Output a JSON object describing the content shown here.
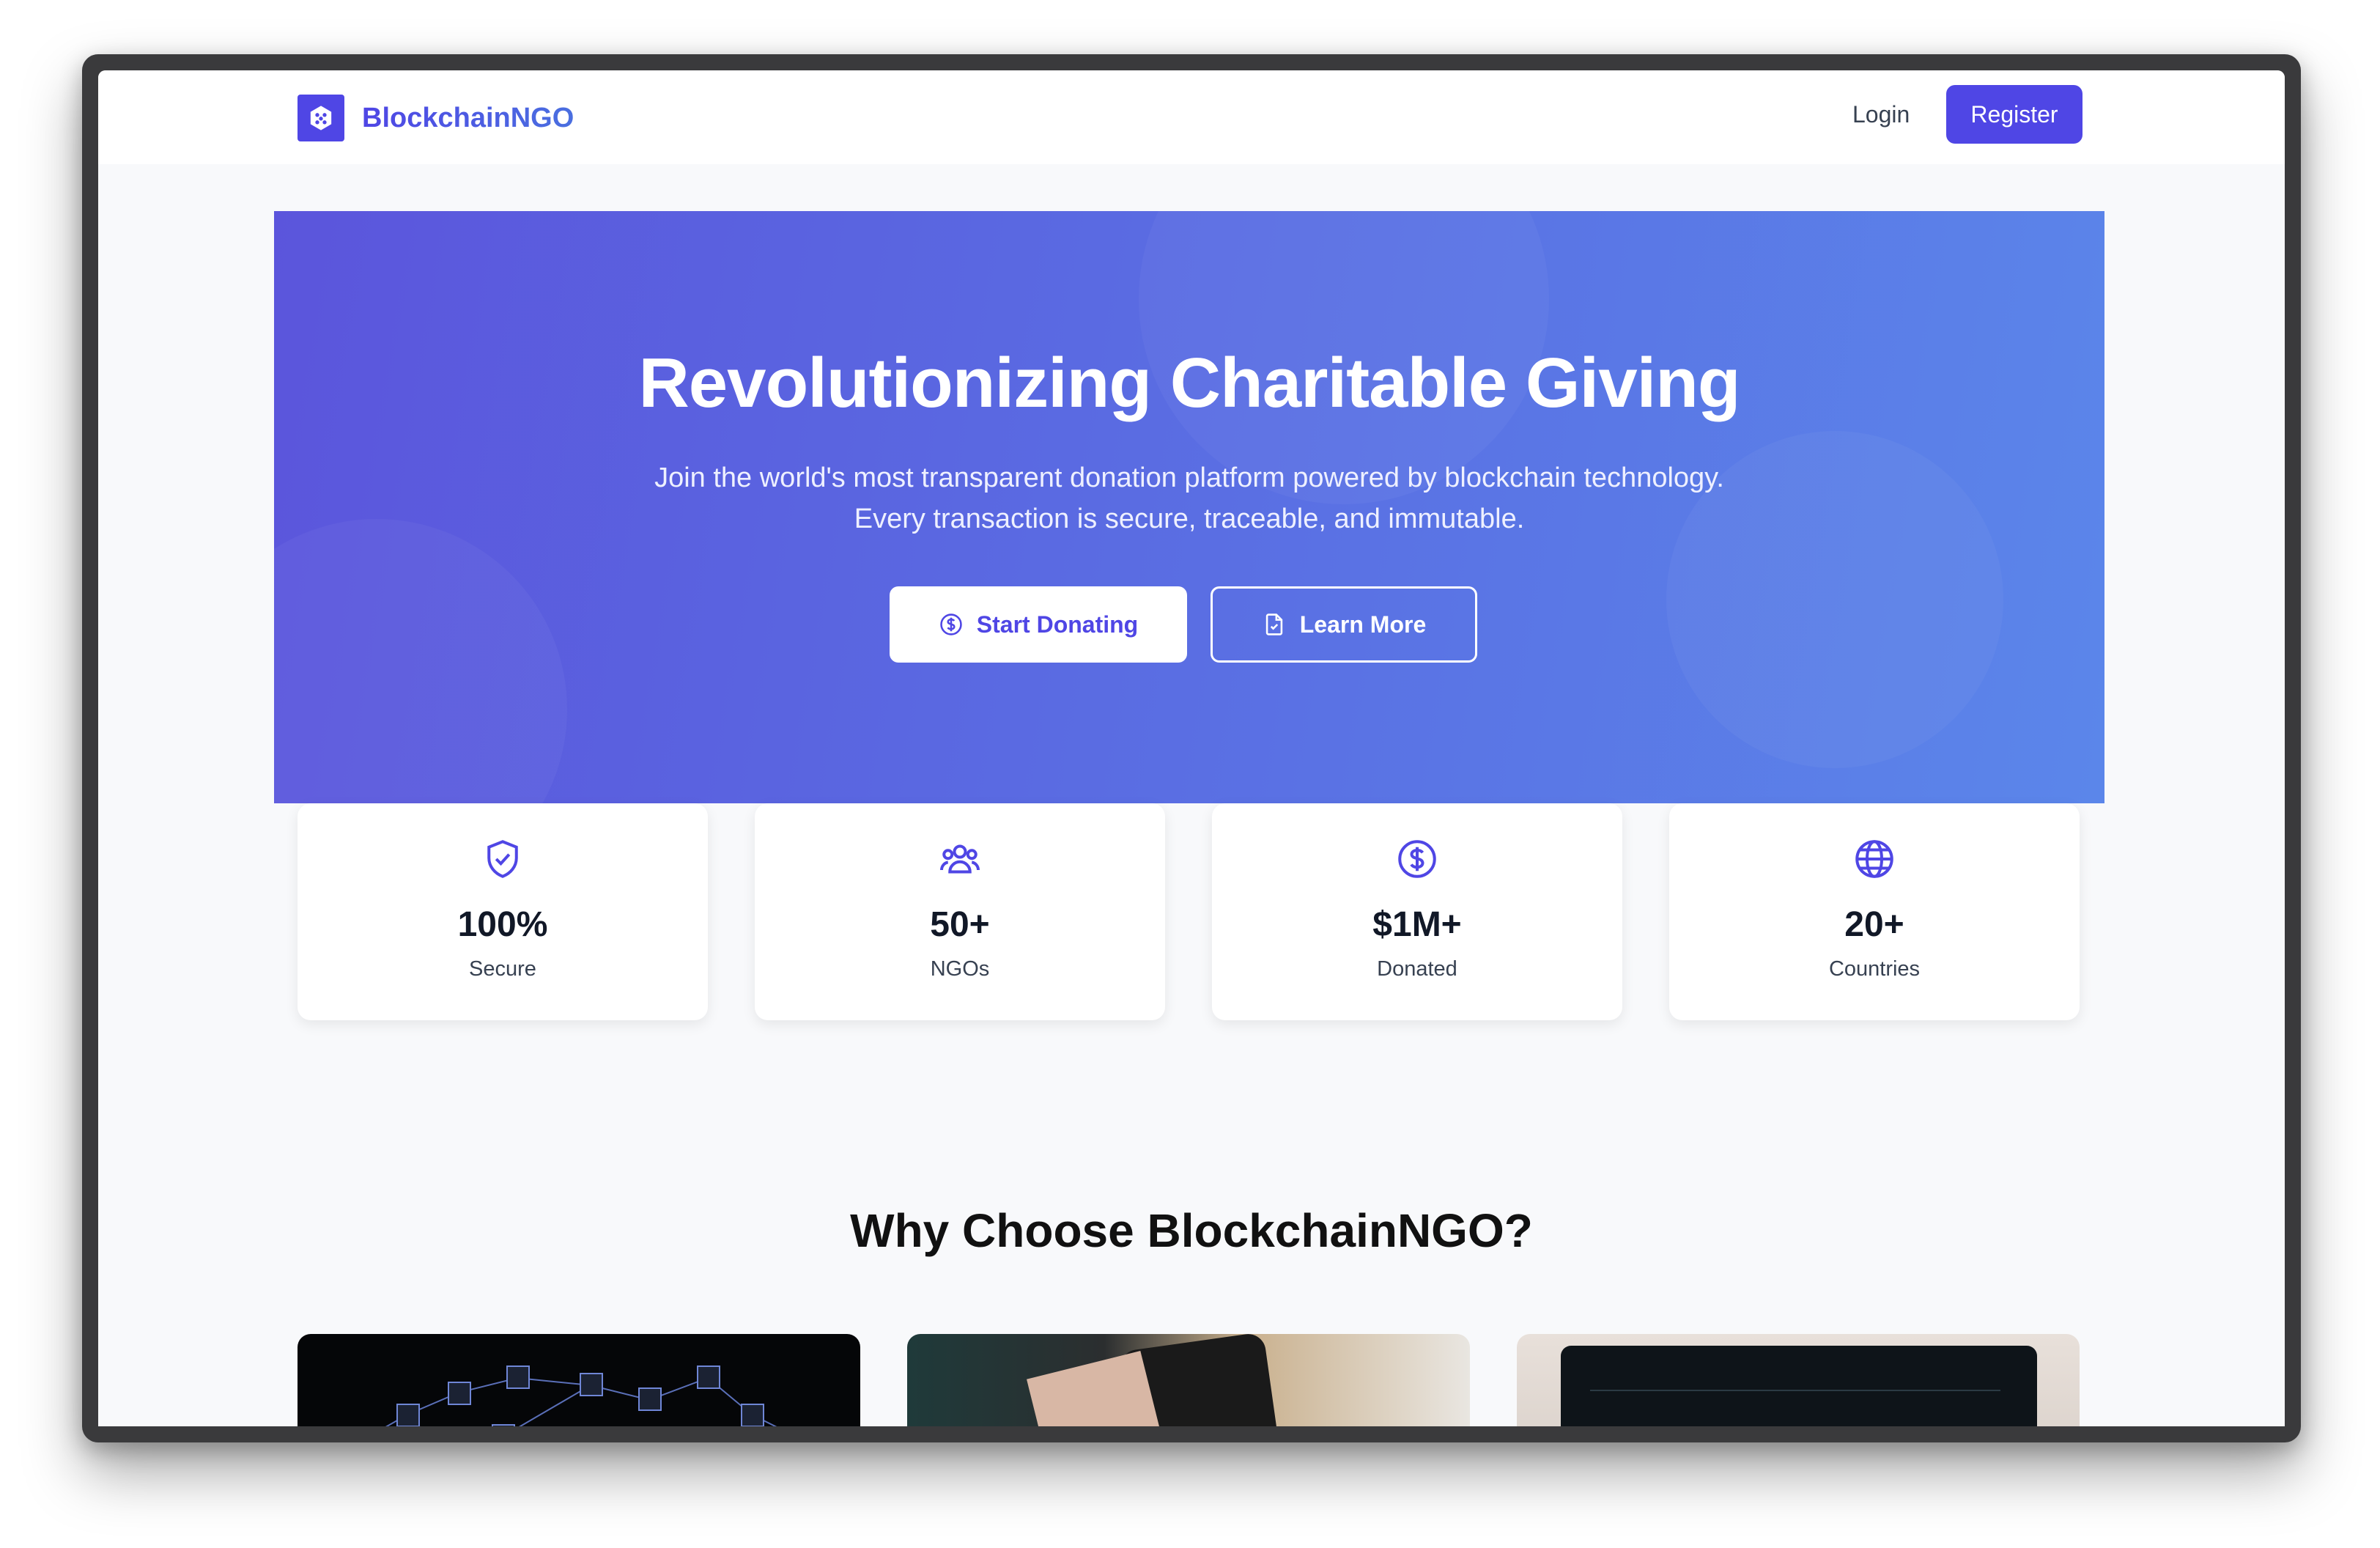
{
  "nav": {
    "brand": "BlockchainNGO",
    "login": "Login",
    "register": "Register"
  },
  "hero": {
    "title": "Revolutionizing Charitable Giving",
    "subtitle_line1": "Join the world's most transparent donation platform powered by blockchain technology.",
    "subtitle_line2": "Every transaction is secure, traceable, and immutable.",
    "primary_button": "Start Donating",
    "secondary_button": "Learn More"
  },
  "stats": [
    {
      "icon": "shield-check-icon",
      "value": "100%",
      "label": "Secure"
    },
    {
      "icon": "users-icon",
      "value": "50+",
      "label": "NGOs"
    },
    {
      "icon": "dollar-circle-icon",
      "value": "$1M+",
      "label": "Donated"
    },
    {
      "icon": "globe-icon",
      "value": "20+",
      "label": "Countries"
    }
  ],
  "features": {
    "title": "Why Choose BlockchainNGO?"
  },
  "colors": {
    "brand": "#4f46e5",
    "hero_gradient_start": "#5b55dc",
    "hero_gradient_end": "#5b86ea"
  }
}
